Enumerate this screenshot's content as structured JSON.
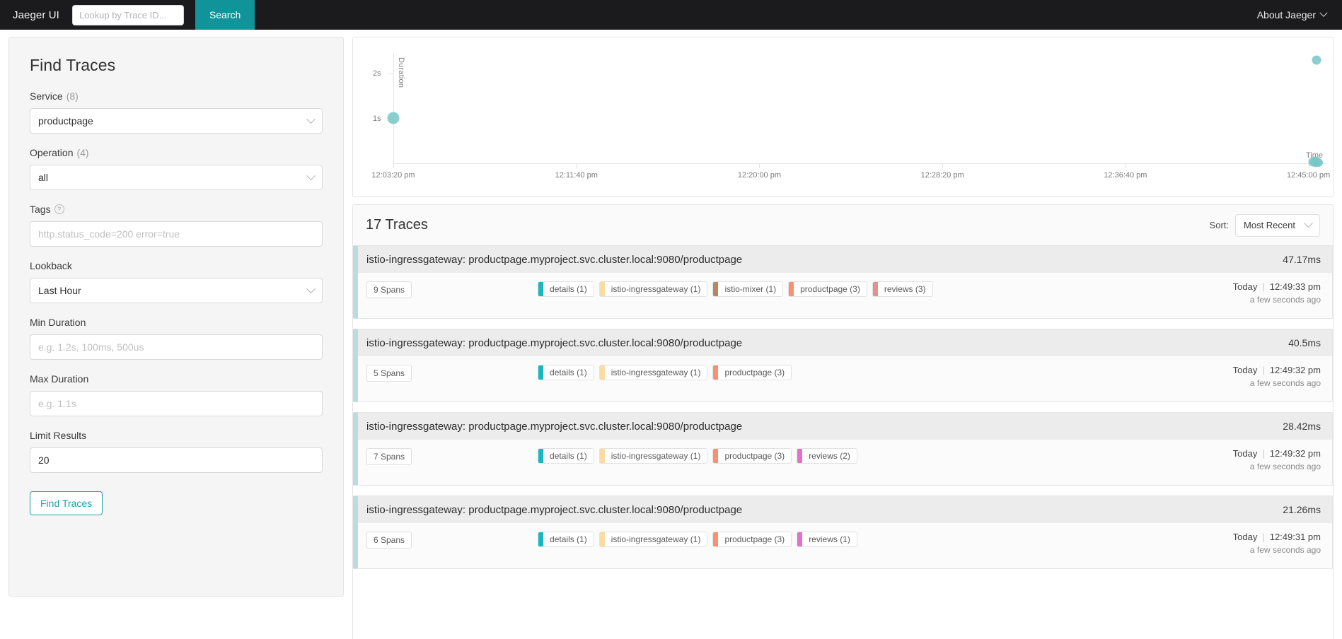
{
  "header": {
    "brand": "Jaeger UI",
    "trace_id_placeholder": "Lookup by Trace ID...",
    "trace_id_value": "",
    "search_button": "Search",
    "about_label": "About Jaeger",
    "about_icon": "chevron-down-icon",
    "background": "#1b1b1d",
    "accent": "#11939a"
  },
  "sidebar": {
    "title": "Find Traces",
    "service": {
      "label": "Service",
      "count": "(8)",
      "value": "productpage"
    },
    "operation": {
      "label": "Operation",
      "count": "(4)",
      "value": "all"
    },
    "tags": {
      "label": "Tags",
      "help_icon": "question-circle-icon",
      "value": "",
      "placeholder": "http.status_code=200 error=true"
    },
    "lookback": {
      "label": "Lookback",
      "value": "Last Hour"
    },
    "min_duration": {
      "label": "Min Duration",
      "value": "",
      "placeholder": "e.g. 1.2s, 100ms, 500us"
    },
    "max_duration": {
      "label": "Max Duration",
      "value": "",
      "placeholder": "e.g. 1.1s"
    },
    "limit_results": {
      "label": "Limit Results",
      "value": "20"
    },
    "find_button": "Find Traces"
  },
  "chart_data": {
    "type": "scatter",
    "title": "",
    "xlabel": "Time",
    "ylabel": "Duration",
    "grid": false,
    "legend": "none",
    "point_color": "#75c6c8",
    "yticks": [
      "1s",
      "2s"
    ],
    "ytick_values": [
      1,
      2
    ],
    "ylim": [
      0,
      2.45
    ],
    "xticks": [
      "12:03:20 pm",
      "12:11:40 pm",
      "12:20:00 pm",
      "12:28:20 pm",
      "12:36:40 pm",
      "12:45:00 pm"
    ],
    "xtick_positions_pct": [
      0,
      19.6,
      39.2,
      58.8,
      78.4,
      98.0
    ],
    "points": [
      {
        "x_pct": 0.0,
        "y_label": "1s",
        "y_value": 1.02,
        "size": 17
      },
      {
        "x_pct": 98.9,
        "y_label": "2.3s",
        "y_value": 2.3,
        "size": 13
      },
      {
        "x_pct": 98.8,
        "y_label": "47.17ms",
        "y_value": 0.047,
        "size": 15
      },
      {
        "x_pct": 98.5,
        "y_label": "40.5ms",
        "y_value": 0.04,
        "size": 13
      },
      {
        "x_pct": 99.1,
        "y_label": "28.42ms",
        "y_value": 0.028,
        "size": 12
      }
    ]
  },
  "results": {
    "count_label": "17 Traces",
    "sort_label": "Sort:",
    "sort_value": "Most Recent",
    "sort_icon": "chevron-down-icon",
    "traces": [
      {
        "title": "istio-ingressgateway: productpage.myproject.svc.cluster.local:9080/productpage",
        "duration": "47.17ms",
        "spans": "9 Spans",
        "day": "Today",
        "time": "12:49:33 pm",
        "relative": "a few seconds ago",
        "services": [
          {
            "name": "details (1)",
            "color": "#17b8be"
          },
          {
            "name": "istio-ingressgateway (1)",
            "color": "#f8dca1"
          },
          {
            "name": "istio-mixer (1)",
            "color": "#b7885e"
          },
          {
            "name": "productpage (3)",
            "color": "#fd8f70"
          },
          {
            "name": "reviews (3)",
            "color": "#e3908e"
          }
        ]
      },
      {
        "title": "istio-ingressgateway: productpage.myproject.svc.cluster.local:9080/productpage",
        "duration": "40.5ms",
        "spans": "5 Spans",
        "day": "Today",
        "time": "12:49:32 pm",
        "relative": "a few seconds ago",
        "services": [
          {
            "name": "details (1)",
            "color": "#17b8be"
          },
          {
            "name": "istio-ingressgateway (1)",
            "color": "#f8dca1"
          },
          {
            "name": "productpage (3)",
            "color": "#fd8f70"
          }
        ]
      },
      {
        "title": "istio-ingressgateway: productpage.myproject.svc.cluster.local:9080/productpage",
        "duration": "28.42ms",
        "spans": "7 Spans",
        "day": "Today",
        "time": "12:49:32 pm",
        "relative": "a few seconds ago",
        "services": [
          {
            "name": "details (1)",
            "color": "#17b8be"
          },
          {
            "name": "istio-ingressgateway (1)",
            "color": "#f8dca1"
          },
          {
            "name": "productpage (3)",
            "color": "#fd8f70"
          },
          {
            "name": "reviews (2)",
            "color": "#e072c8"
          }
        ]
      },
      {
        "title": "istio-ingressgateway: productpage.myproject.svc.cluster.local:9080/productpage",
        "duration": "21.26ms",
        "spans": "6 Spans",
        "day": "Today",
        "time": "12:49:31 pm",
        "relative": "a few seconds ago",
        "services": [
          {
            "name": "details (1)",
            "color": "#17b8be"
          },
          {
            "name": "istio-ingressgateway (1)",
            "color": "#f8dca1"
          },
          {
            "name": "productpage (3)",
            "color": "#fd8f70"
          },
          {
            "name": "reviews (1)",
            "color": "#e072c8"
          }
        ]
      }
    ]
  }
}
